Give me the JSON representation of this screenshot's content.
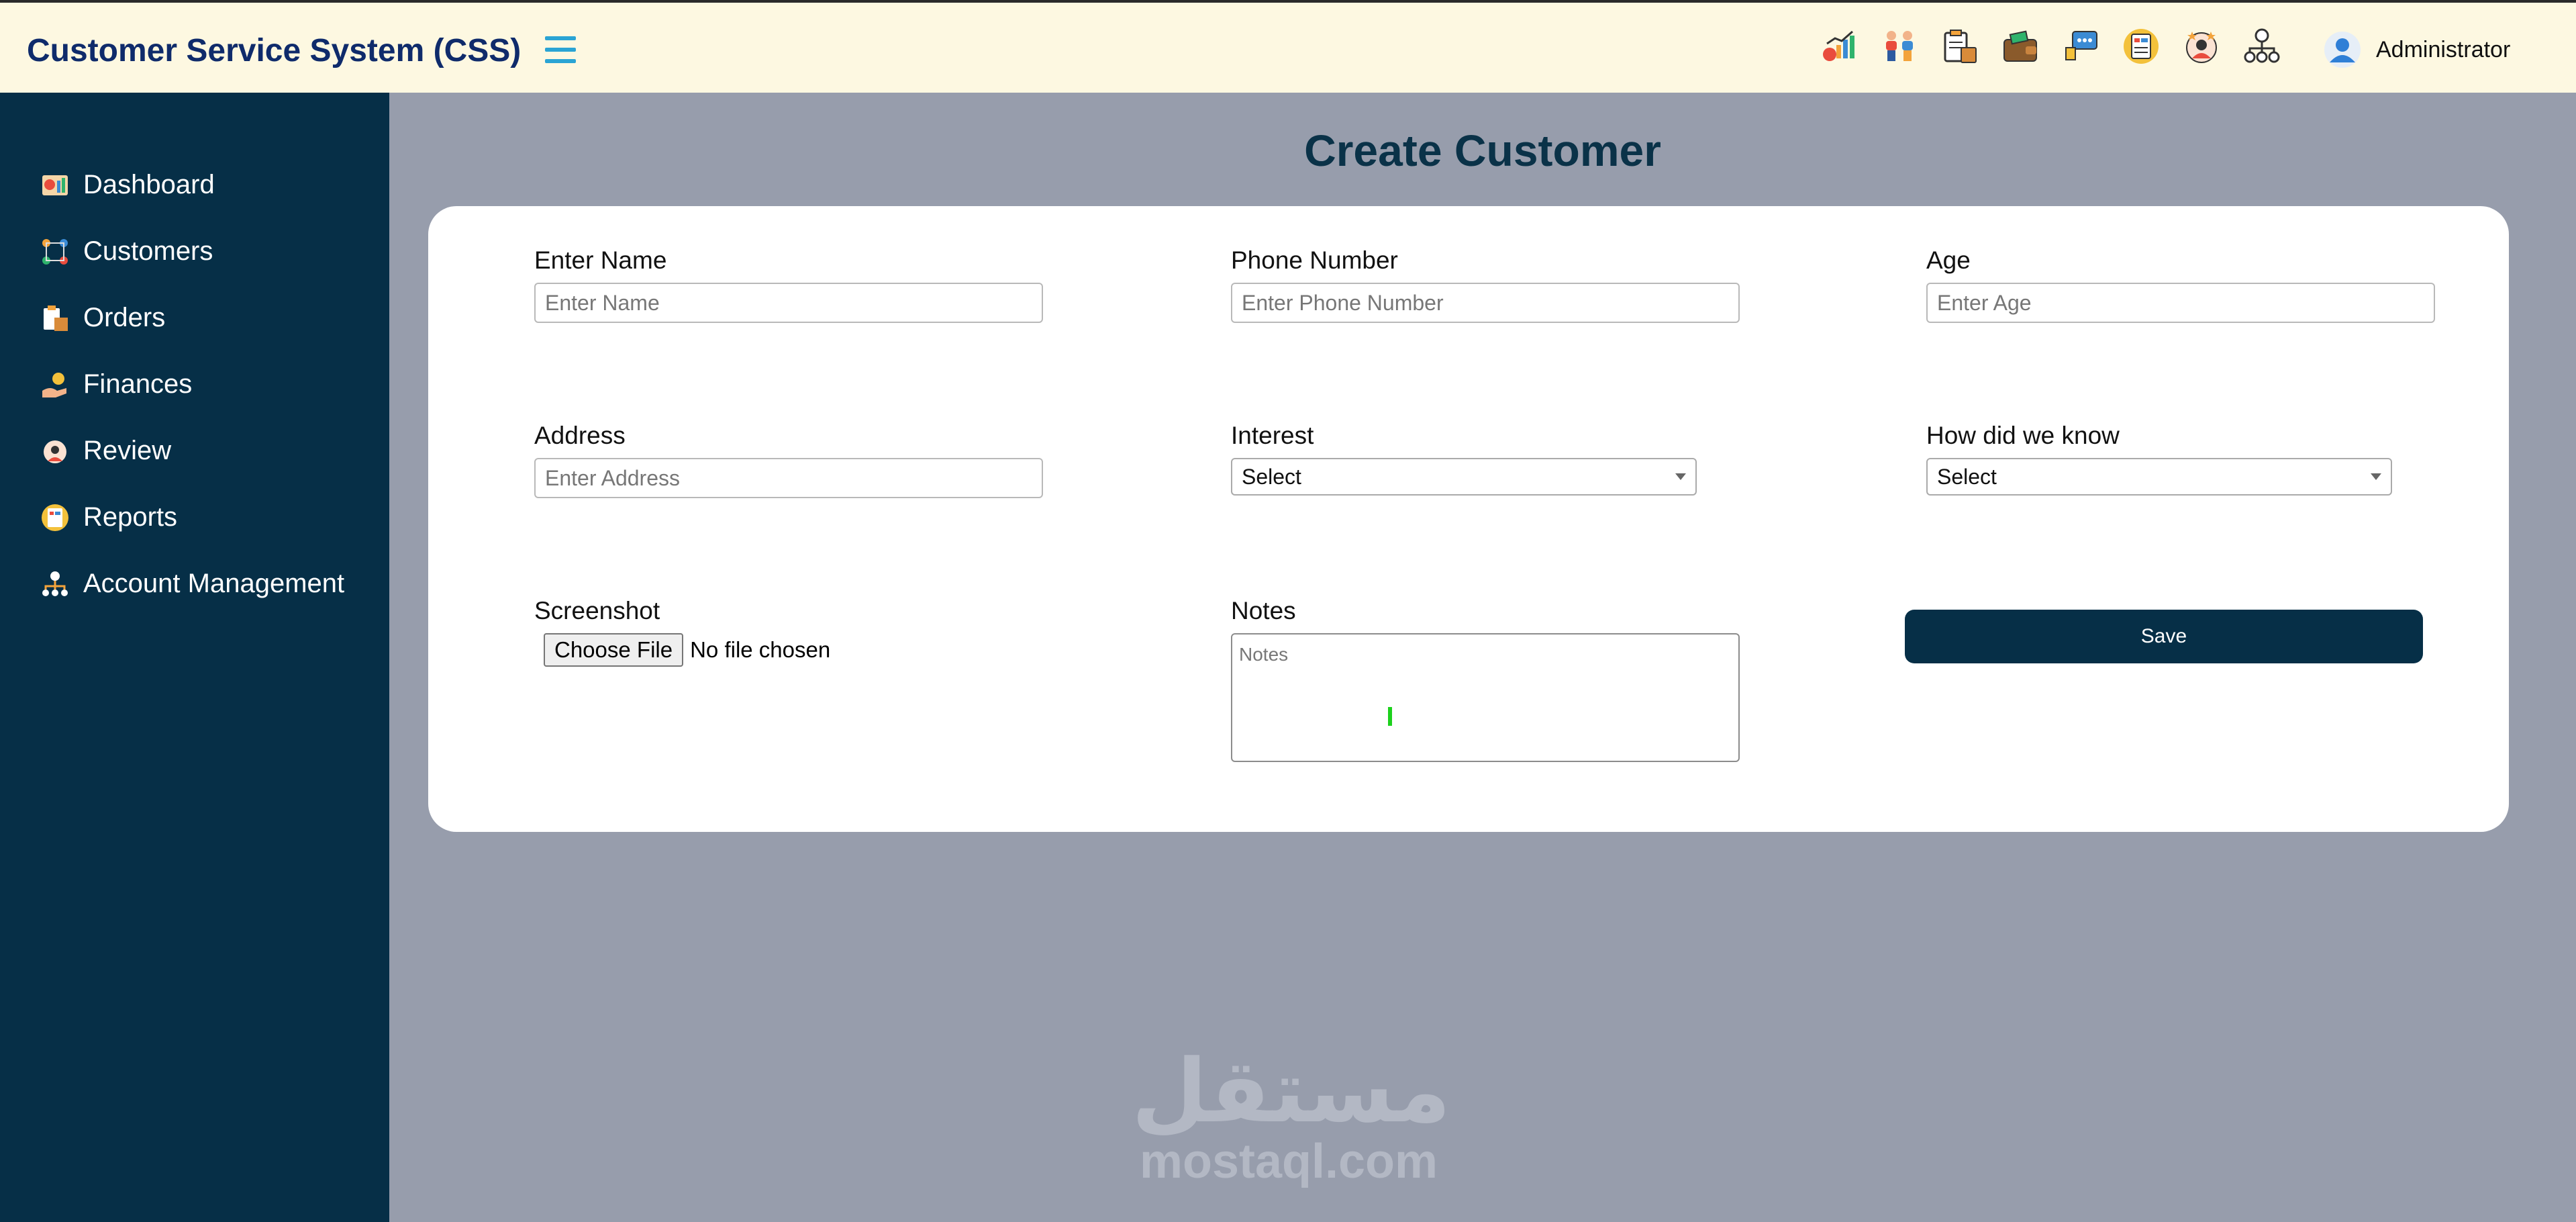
{
  "header": {
    "title": "Customer Service System (CSS)",
    "icons": [
      "dashboard-chart-icon",
      "customers-people-icon",
      "orders-clipboard-icon",
      "wallet-icon",
      "review-feedback-icon",
      "reports-document-icon",
      "rating-badge-icon",
      "org-structure-icon"
    ],
    "user": {
      "name": "Administrator",
      "icon": "user-avatar-icon"
    }
  },
  "sidebar": {
    "items": [
      {
        "label": "Dashboard",
        "icon": "dashboard-icon"
      },
      {
        "label": "Customers",
        "icon": "customers-icon"
      },
      {
        "label": "Orders",
        "icon": "orders-icon"
      },
      {
        "label": "Finances",
        "icon": "finances-icon"
      },
      {
        "label": "Review",
        "icon": "review-icon"
      },
      {
        "label": "Reports",
        "icon": "reports-icon"
      },
      {
        "label": "Account Management",
        "icon": "account-management-icon"
      }
    ]
  },
  "page": {
    "title": "Create Customer"
  },
  "form": {
    "name": {
      "label": "Enter Name",
      "placeholder": "Enter Name",
      "value": ""
    },
    "phone": {
      "label": "Phone Number",
      "placeholder": "Enter Phone Number",
      "value": ""
    },
    "age": {
      "label": "Age",
      "placeholder": "Enter Age",
      "value": ""
    },
    "address": {
      "label": "Address",
      "placeholder": "Enter Address",
      "value": ""
    },
    "interest": {
      "label": "Interest",
      "selected": "Select"
    },
    "source": {
      "label": "How did we know",
      "selected": "Select"
    },
    "screenshot": {
      "label": "Screenshot",
      "button": "Choose File",
      "status": "No file chosen"
    },
    "notes": {
      "label": "Notes",
      "placeholder": "Notes",
      "value": ""
    },
    "save": {
      "label": "Save"
    }
  },
  "watermark": {
    "arabic": "مستقل",
    "latin": "mostaql.com"
  },
  "colors": {
    "header_bg": "#fdf8e1",
    "sidebar_bg": "#062f47",
    "main_bg": "#979dac",
    "title": "#0f2b6b",
    "accent": "#2aa4d4"
  }
}
